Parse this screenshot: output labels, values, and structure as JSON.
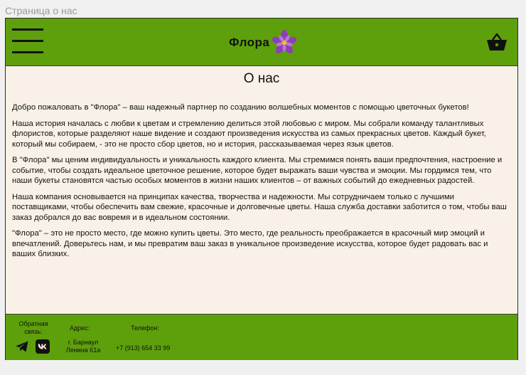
{
  "frame_title": "Страница о нас",
  "header": {
    "logo_text": "Флора",
    "menu_icon": "hamburger-menu-icon",
    "cart_icon": "basket-icon"
  },
  "main": {
    "title": "О нас",
    "paragraphs": [
      "Добро пожаловать в \"Флора\" – ваш надежный партнер по созданию волшебных моментов с помощью цветочных букетов!",
      "Наша история началась с любви к цветам и стремлению делиться этой любовью с миром. Мы собрали команду талантливых флористов, которые разделяют наше видение и создают произведения искусства из самых прекрасных цветов. Каждый букет, который мы собираем, - это не просто сбор цветов, но и история, рассказываемая через язык цветов.",
      "В \"Флора\" мы ценим индивидуальность и уникальность каждого клиента. Мы стремимся понять ваши предпочтения, настроение и событие, чтобы создать идеальное цветочное решение, которое будет выражать ваши чувства и эмоции. Мы гордимся тем, что наши букеты становятся частью особых моментов в жизни наших клиентов – от важных событий до ежедневных радостей.",
      "Наша компания основывается на принципах качества, творчества и надежности. Мы сотрудничаем только с лучшими поставщиками, чтобы обеспечить вам свежие, красочные и долговечные цветы. Наша служба доставки заботится о том, чтобы ваш заказ добрался до вас вовремя и в идеальном состоянии.",
      "\"Флора\" – это не просто место, где можно купить цветы. Это место, где реальность преображается в красочный мир эмоций и впечатлений. Доверьтесь нам, и мы превратим ваш заказ в уникальное произведение искусства, которое будет радовать вас и ваших близких."
    ]
  },
  "footer": {
    "social_label": "Обратная связь:",
    "address_label": "Адрес:",
    "address_value": "г. Барнаул Ленина 61а",
    "phone_label": "Телефон:",
    "phone_value": "+7 (913) 654 33 99",
    "social_icons": [
      "telegram-icon",
      "vk-icon"
    ]
  },
  "colors": {
    "brand_green": "#5ea00b",
    "page_bg": "#f9f1e7",
    "flower_purple": "#8e3fb8",
    "flower_center": "#f2c21a"
  }
}
